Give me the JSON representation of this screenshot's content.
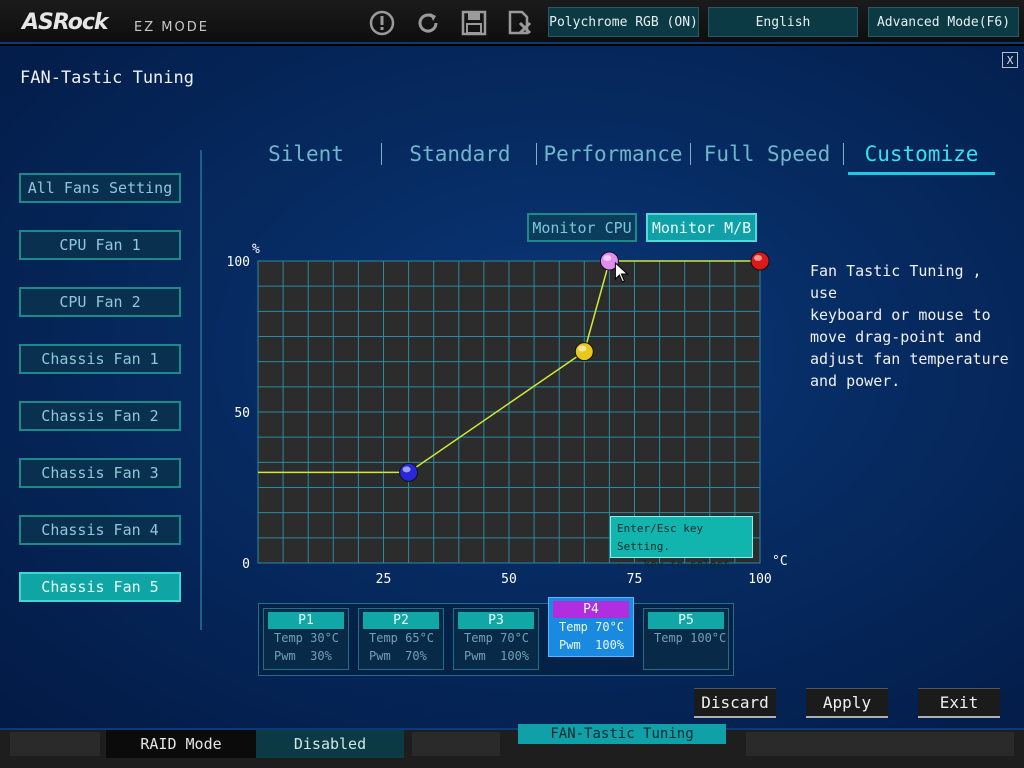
{
  "header": {
    "logo": "ASRock",
    "mode": "EZ MODE",
    "icons": [
      "info-icon",
      "refresh-icon",
      "save-icon",
      "discard-icon"
    ],
    "buttons": {
      "polychrome": "Polychrome RGB (ON)",
      "language": "English",
      "advanced": "Advanced Mode(F6)"
    }
  },
  "panel": {
    "title": "FAN-Tastic Tuning",
    "close": "X"
  },
  "sidebar": {
    "items": [
      {
        "label": "All Fans Setting"
      },
      {
        "label": "CPU Fan 1"
      },
      {
        "label": "CPU Fan 2"
      },
      {
        "label": "Chassis Fan 1"
      },
      {
        "label": "Chassis Fan 2"
      },
      {
        "label": "Chassis Fan 3"
      },
      {
        "label": "Chassis Fan 4"
      },
      {
        "label": "Chassis Fan 5"
      }
    ],
    "active": "Chassis Fan 5"
  },
  "tabs": [
    {
      "label": "Silent"
    },
    {
      "label": "Standard"
    },
    {
      "label": "Performance"
    },
    {
      "label": "Full Speed"
    },
    {
      "label": "Customize"
    }
  ],
  "active_tab": "Customize",
  "monitor": {
    "cpu": "Monitor CPU",
    "mb": "Monitor M/B",
    "active": "Monitor M/B"
  },
  "chart_data": {
    "type": "line",
    "xlabel": "°C",
    "ylabel": "%",
    "xlim": [
      0,
      100
    ],
    "ylim": [
      0,
      100
    ],
    "x_ticks": [
      25,
      50,
      75,
      100
    ],
    "y_ticks": [
      0,
      50,
      100
    ],
    "grid": true,
    "line_color": "#cfe83a",
    "series": [
      {
        "values": [
          {
            "x": 0,
            "y": 30
          },
          {
            "x": 30,
            "y": 30
          },
          {
            "x": 65,
            "y": 70
          },
          {
            "x": 70,
            "y": 100
          },
          {
            "x": 100,
            "y": 100
          }
        ]
      }
    ],
    "drag_points": [
      {
        "label": "P1",
        "x": 30,
        "y": 30,
        "color": "#2828d8"
      },
      {
        "label": "P2",
        "x": 65,
        "y": 70,
        "color": "#e6c81e"
      },
      {
        "label": "P3",
        "x": 70,
        "y": 100,
        "color": "#e08cf0"
      },
      {
        "label": "P4",
        "x": 70,
        "y": 100,
        "color": "#e08cf0"
      },
      {
        "label": "P5",
        "x": 100,
        "y": 100,
        "color": "#e01818"
      }
    ],
    "tick_text": {
      "x0": "0",
      "y0": "0"
    }
  },
  "description": "Fan Tastic Tuning , use\nkeyboard or mouse to\nmove drag-point and\nadjust fan temperature\nand power.",
  "hint": {
    "line1": "Enter/Esc key Setting.",
    "line2": "← → key to select."
  },
  "points": [
    {
      "name": "P1",
      "temp": "Temp 30°C",
      "pwm": "Pwm  30%"
    },
    {
      "name": "P2",
      "temp": "Temp 65°C",
      "pwm": "Pwm  70%"
    },
    {
      "name": "P3",
      "temp": "Temp 70°C",
      "pwm": "Pwm  100%"
    },
    {
      "name": "P4",
      "temp": "Temp 70°C",
      "pwm": "Pwm  100%"
    },
    {
      "name": "P5",
      "temp": "Temp 100°C",
      "pwm": ""
    }
  ],
  "selected_point": "P4",
  "actions": {
    "discard": "Discard",
    "apply": "Apply",
    "exit": "Exit"
  },
  "footer": {
    "raid_label": "RAID Mode",
    "raid_value": "Disabled",
    "tab": "FAN-Tastic Tuning"
  }
}
